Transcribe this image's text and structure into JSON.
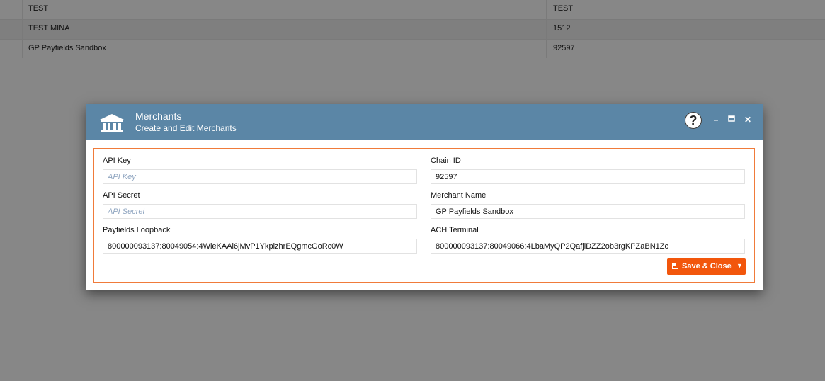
{
  "background_table": {
    "rows": [
      {
        "name": "TEST",
        "chain_id": "TEST"
      },
      {
        "name": "TEST MINA",
        "chain_id": "1512"
      },
      {
        "name": "GP Payfields Sandbox",
        "chain_id": "92597"
      }
    ]
  },
  "dialog": {
    "title": "Merchants",
    "subtitle": "Create and Edit Merchants",
    "help_label": "?",
    "minimize_label": "–",
    "maximize_label": "▬",
    "close_label": "✕"
  },
  "form": {
    "api_key": {
      "label": "API Key",
      "value": "",
      "placeholder": "API Key"
    },
    "api_secret": {
      "label": "API Secret",
      "value": "",
      "placeholder": "API Secret"
    },
    "payfields_loopback": {
      "label": "Payfields Loopback",
      "value": "800000093137:80049054:4WleKAAi6jMvP1YkplzhrEQgmcGoRc0W"
    },
    "chain_id": {
      "label": "Chain ID",
      "value": "92597"
    },
    "merchant_name": {
      "label": "Merchant Name",
      "value": "GP Payfields Sandbox"
    },
    "ach_terminal": {
      "label": "ACH Terminal",
      "value": "800000093137:80049066:4LbaMyQP2QafjlDZZ2ob3rgKPZaBN1Zc"
    }
  },
  "actions": {
    "save_close_label": "Save & Close",
    "dropdown_caret": "▼"
  },
  "colors": {
    "header_bg": "#5b86a6",
    "accent_orange": "#f2560c",
    "panel_border": "#f07b3a"
  }
}
